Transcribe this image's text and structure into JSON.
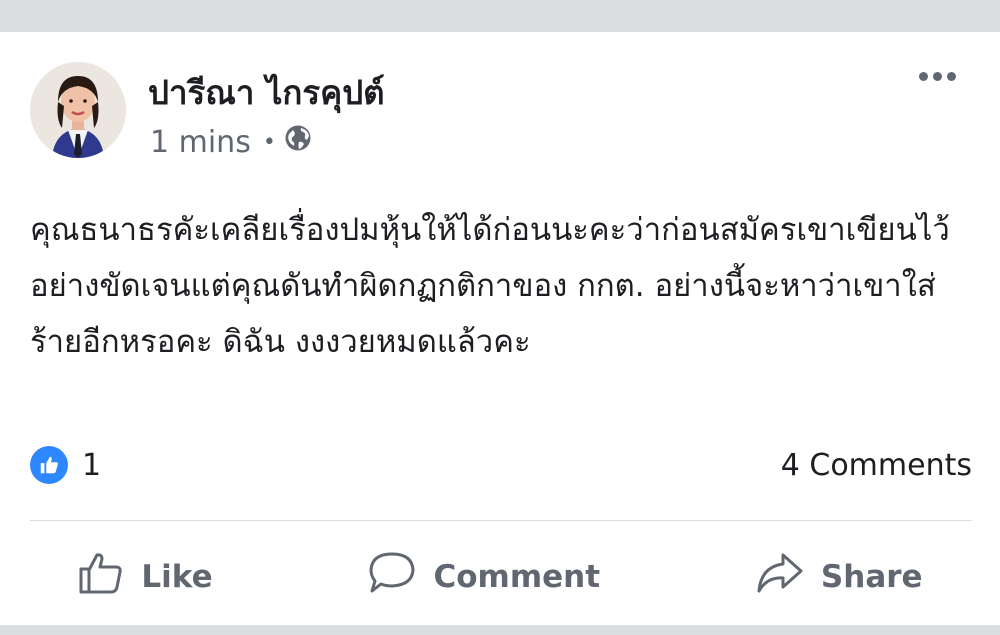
{
  "post": {
    "author": "ปารีณา ไกรคุปต์",
    "time": "1 mins",
    "separator": "•",
    "privacy_icon": "globe-icon",
    "body": "คุณธนาธรคัะเคลียเรื่องปมหุ้นให้ได้ก่อนนะคะว่าก่อนสมัครเขาเขียนไว้อย่างขัดเจนแต่คุณดันทำผิดกฏกติกาของ กกต. อย่างนี้จะหาว่าเขาใส่ร้ายอีกหรอคะ ดิฉัน งงงวยหมดแล้วคะ",
    "reactions_count": "1",
    "comments_count": "4 Comments"
  },
  "actions": {
    "like": "Like",
    "comment": "Comment",
    "share": "Share"
  },
  "colors": {
    "accent": "#2d88ff",
    "text": "#1c1e21",
    "muted": "#606770",
    "page_bg": "#dcdde1"
  }
}
